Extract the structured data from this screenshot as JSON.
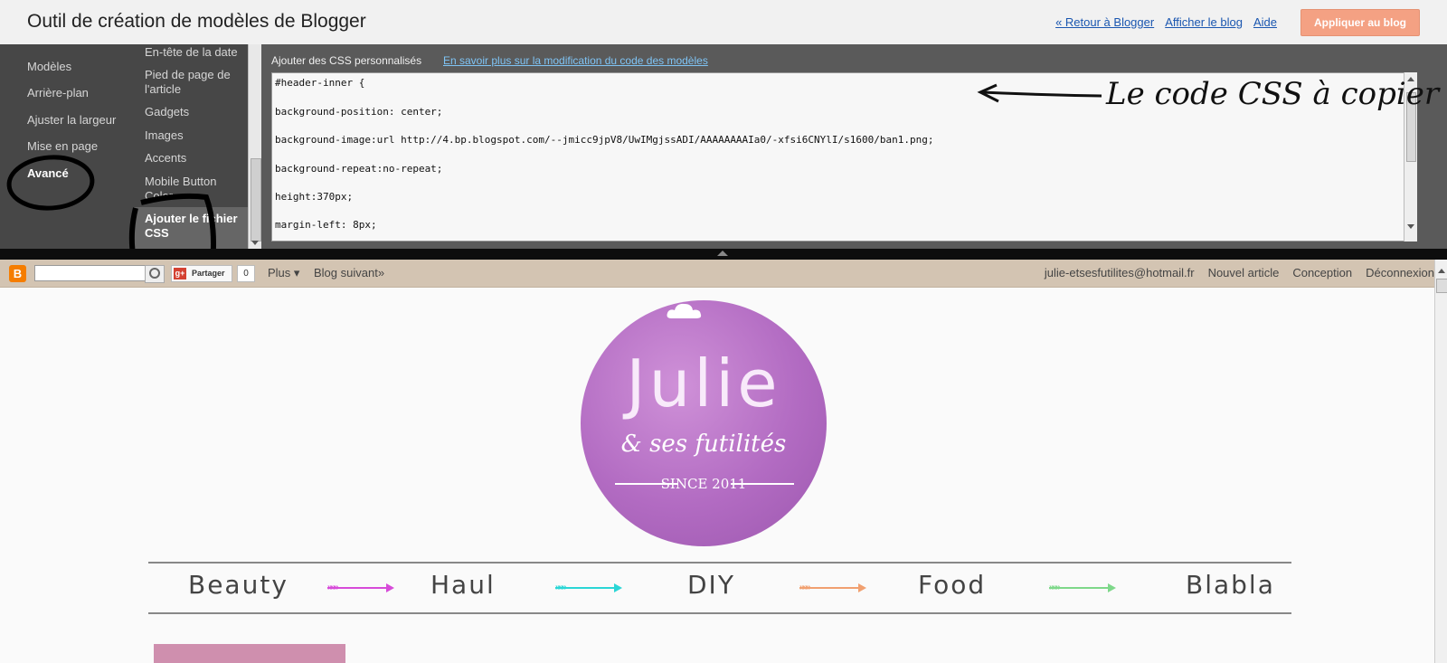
{
  "app": {
    "title": "Outil de création de modèles de Blogger",
    "links": [
      "« Retour à Blogger",
      "Afficher le blog",
      "Aide"
    ],
    "apply_label": "Appliquer au blog"
  },
  "nav": {
    "items": [
      "Modèles",
      "Arrière-plan",
      "Ajuster la largeur",
      "Mise en page",
      "Avancé"
    ],
    "active": "Avancé",
    "sub_items": [
      "En-tête de la date",
      "Pied de page de l'article",
      "Gadgets",
      "Images",
      "Accents",
      "Mobile Button Color",
      "Ajouter le fichier CSS"
    ],
    "sub_active": "Ajouter le fichier CSS"
  },
  "css_panel": {
    "label": "Ajouter des CSS personnalisés",
    "help_link": "En savoir plus sur la modification du code des modèles",
    "code_lines": [
      "#header-inner {",
      "background-position: center;",
      "background-image:url http://4.bp.blogspot.com/--jmicc9jpV8/UwIMgjssADI/AAAAAAAAIa0/-xfsi6CNYlI/s1600/ban1.png;",
      "background-repeat:no-repeat;",
      "height:370px;",
      "margin-left: 8px;"
    ]
  },
  "annotation": {
    "text": "Le code CSS à copier"
  },
  "blog_navbar": {
    "share_label": "Partager",
    "share_count": "0",
    "more_label": "Plus",
    "next_blog_label": "Blog suivant»",
    "right_links": [
      "julie-etsesfutilites@hotmail.fr",
      "Nouvel article",
      "Conception",
      "Déconnexion"
    ]
  },
  "blog": {
    "logo_title": "Julie",
    "logo_subtitle": "& ses futilités",
    "logo_since": "SINCE 2011",
    "menu": [
      "Beauty",
      "Haul",
      "DIY",
      "Food",
      "Blabla"
    ],
    "menu_arrow_colors": [
      "#d74bd9",
      "#2bd6d6",
      "#f1a070",
      "#7ed88a"
    ]
  }
}
